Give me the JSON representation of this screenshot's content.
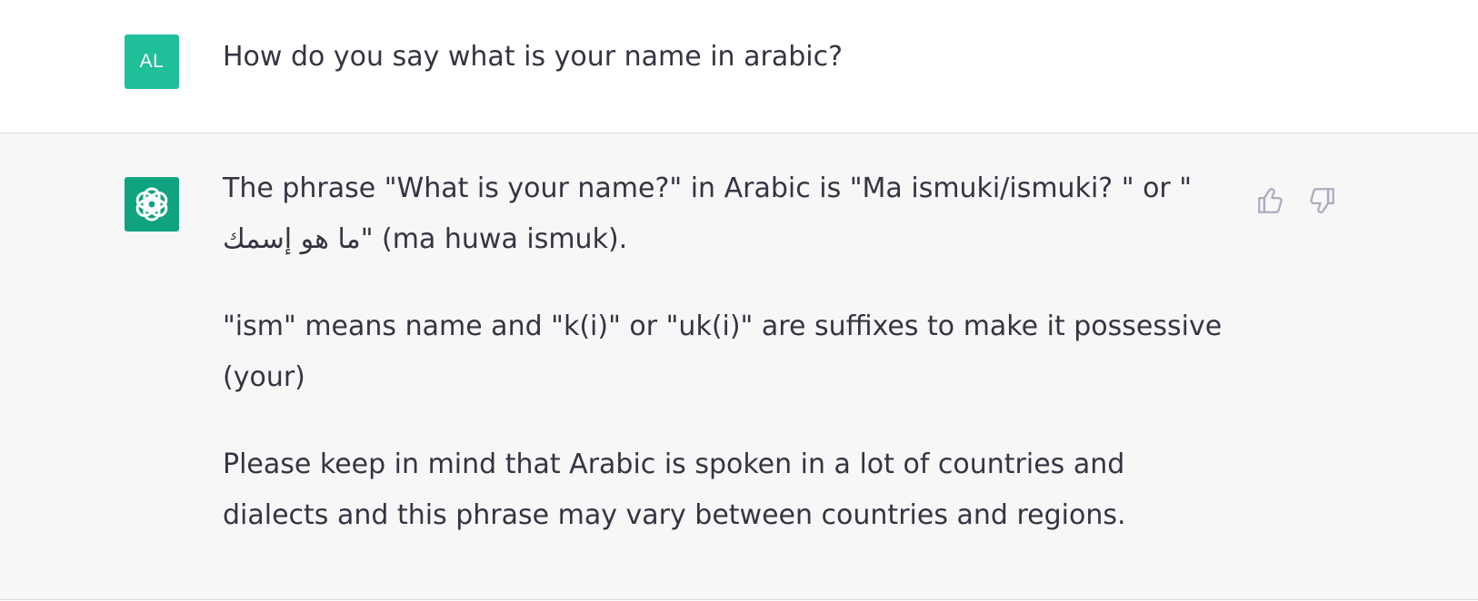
{
  "conversation": {
    "user_message": {
      "avatar_initials": "AL",
      "text": "How do you say what is your name in arabic?"
    },
    "assistant_message": {
      "paragraphs": [
        "The phrase \"What is your name?\" in Arabic is \"Ma ismuki/ismuki? \" or \" ما هو إسمك\" (ma huwa ismuk).",
        "\"ism\" means name and \"k(i)\" or \"uk(i)\" are suffixes to make it possessive (your)",
        "Please keep in mind that Arabic is spoken in a lot of countries and dialects and this phrase may vary between countries and regions."
      ]
    },
    "feedback": {
      "thumbs_up_icon": "thumbs-up-icon",
      "thumbs_down_icon": "thumbs-down-icon"
    }
  },
  "colors": {
    "user_avatar": "#1fbf99",
    "assistant_avatar": "#10a37f",
    "assistant_row_background": "#f7f7f8",
    "text": "#343541"
  }
}
